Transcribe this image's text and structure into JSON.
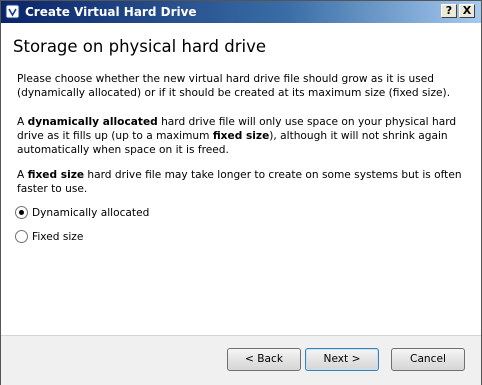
{
  "window": {
    "title": "Create Virtual Hard Drive",
    "help_label": "?",
    "close_label": "X"
  },
  "page": {
    "heading": "Storage on physical hard drive",
    "para1": "Please choose whether the new virtual hard drive file should grow as it is used (dynamically allocated) or if it should be created at its maximum size (fixed size).",
    "para2": {
      "t1": "A ",
      "b1": "dynamically allocated",
      "t2": " hard drive file will only use space on your physical hard drive as it fills up (up to a maximum ",
      "b2": "fixed size",
      "t3": "), although it will not shrink again automatically when space on it is freed."
    },
    "para3": {
      "t1": "A ",
      "b1": "fixed size",
      "t2": " hard drive file may take longer to create on some systems but is often faster to use."
    }
  },
  "options": [
    {
      "label": "Dynamically allocated",
      "selected": true
    },
    {
      "label": "Fixed size",
      "selected": false
    }
  ],
  "buttons": {
    "back": "< Back",
    "next": "Next >",
    "cancel": "Cancel"
  }
}
